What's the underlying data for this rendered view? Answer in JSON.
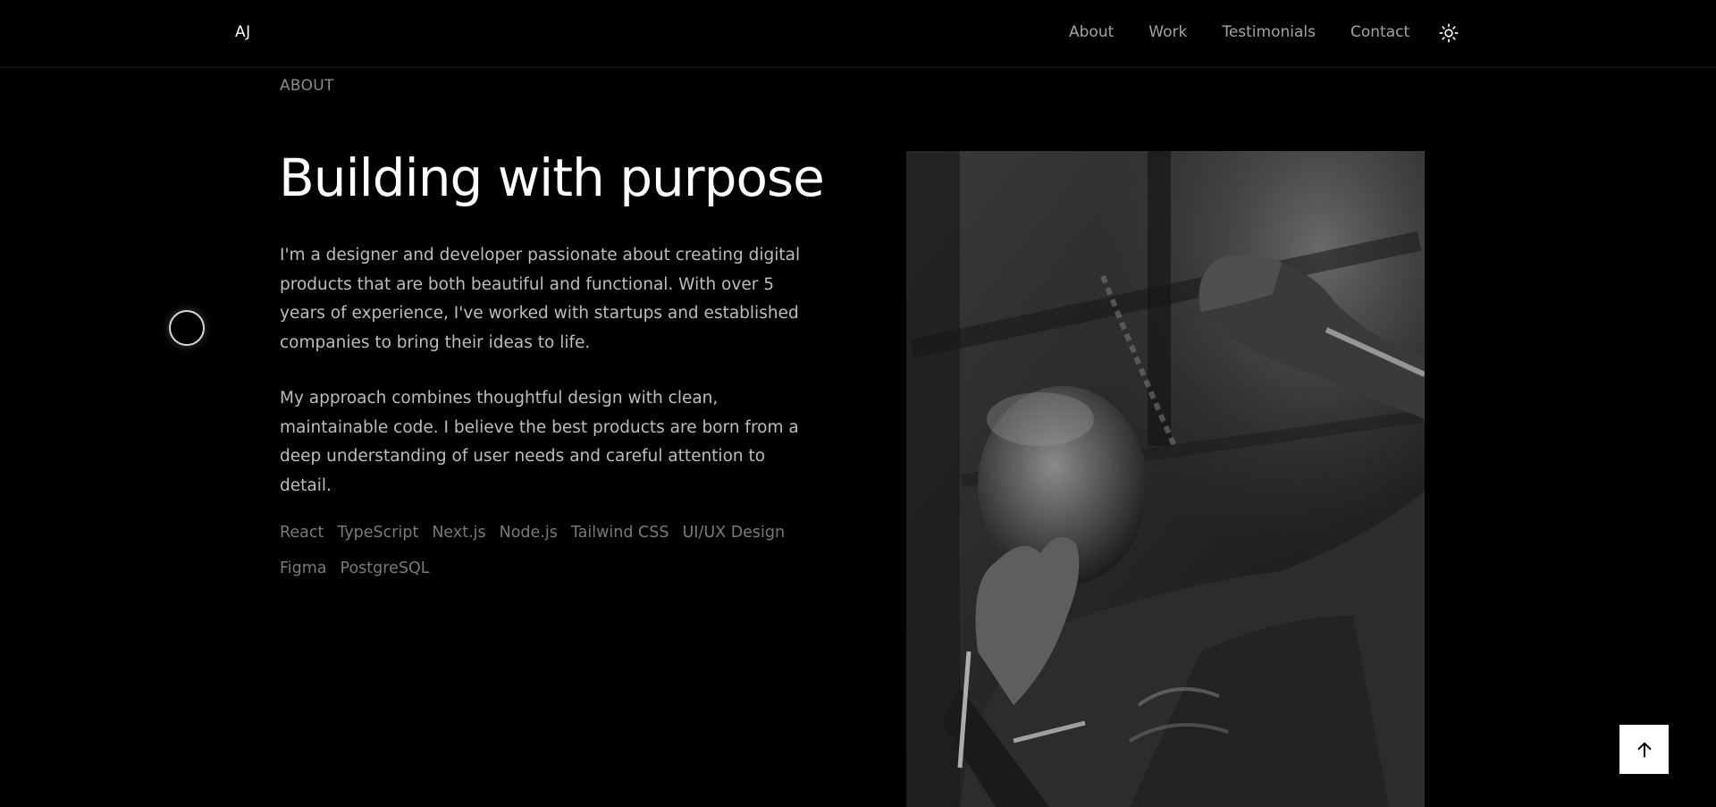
{
  "header": {
    "logo": "AJ",
    "nav": [
      {
        "label": "About"
      },
      {
        "label": "Work"
      },
      {
        "label": "Testimonials"
      },
      {
        "label": "Contact"
      }
    ],
    "theme_toggle_icon": "sun-icon"
  },
  "about": {
    "section_label": "ABOUT",
    "title": "Building with purpose",
    "paragraphs": [
      "I'm a designer and developer passionate about creating digital products that are both beautiful and functional. With over 5 years of experience, I've worked with startups and established companies to bring their ideas to life.",
      "My approach combines thoughtful design with clean, maintainable code. I believe the best products are born from a deep understanding of user needs and careful attention to detail."
    ],
    "skills": [
      "React",
      "TypeScript",
      "Next.js",
      "Node.js",
      "Tailwind CSS",
      "UI/UX Design",
      "Figma",
      "PostgreSQL"
    ],
    "photo_icon": "boxer-portrait-photo"
  },
  "back_to_top_icon": "arrow-up-icon",
  "colors": {
    "background": "#000000",
    "heading": "#ffffff",
    "body_text": "#bdbdbd",
    "muted": "#7a7a7a",
    "nav_text": "#a3a3a3"
  }
}
